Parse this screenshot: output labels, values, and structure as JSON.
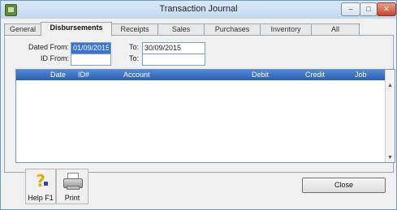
{
  "window": {
    "title": "Transaction Journal",
    "minimize_glyph": "–",
    "maximize_glyph": "□",
    "close_glyph": "✕"
  },
  "tabs": [
    {
      "label": "General",
      "active": false
    },
    {
      "label": "Disbursements",
      "active": true
    },
    {
      "label": "Receipts",
      "active": false
    },
    {
      "label": "Sales",
      "active": false
    },
    {
      "label": "Purchases",
      "active": false
    },
    {
      "label": "Inventory",
      "active": false
    },
    {
      "label": "All",
      "active": false
    }
  ],
  "filters": {
    "dated_from_label": "Dated From:",
    "dated_from_value": "01/09/2015",
    "to_label": "To:",
    "to_value": "30/09/2015",
    "id_from_label": "ID From:",
    "id_from_value": "",
    "id_to_label": "To:",
    "id_to_value": ""
  },
  "grid": {
    "columns": [
      "Date",
      "ID#",
      "Account",
      "Debit",
      "Credit",
      "Job"
    ],
    "rows": []
  },
  "toolbar": {
    "help_label": "Help F1",
    "print_label": "Print",
    "close_label": "Close"
  },
  "colors": {
    "header_accent": "#2b5fb5",
    "selection": "#3a74d0",
    "titlebar": "#c3d8ee"
  },
  "icons": {
    "app": "journal-app-icon",
    "help": "help-question-icon",
    "print": "printer-icon"
  }
}
